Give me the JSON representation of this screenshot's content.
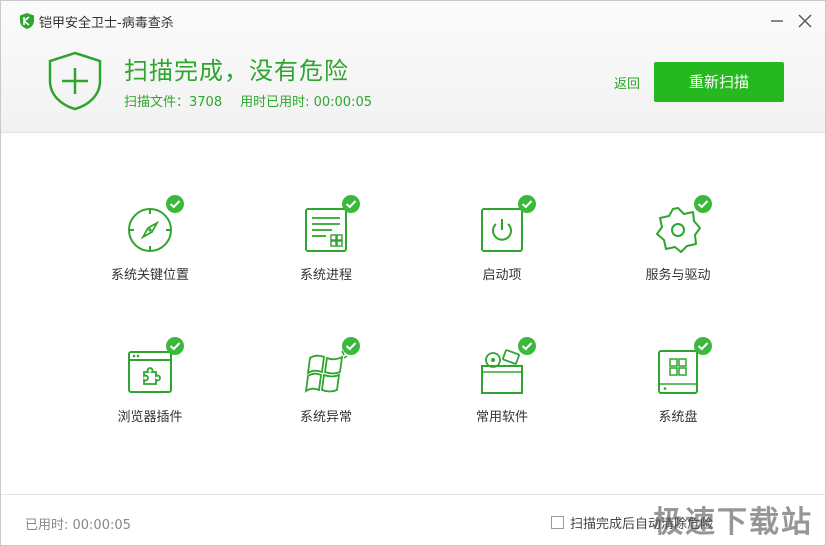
{
  "window": {
    "title": "铠甲安全卫士-病毒查杀"
  },
  "scan_result": {
    "headline": "扫描完成，没有危险",
    "files_label": "扫描文件：3708",
    "time_label": "用时已用时: 00:00:05"
  },
  "actions": {
    "back_label": "返回",
    "rescan_label": "重新扫描"
  },
  "scan_items": [
    {
      "label": "系统关键位置",
      "icon": "compass-icon",
      "status": "ok"
    },
    {
      "label": "系统进程",
      "icon": "process-window-icon",
      "status": "ok"
    },
    {
      "label": "启动项",
      "icon": "power-icon",
      "status": "ok"
    },
    {
      "label": "服务与驱动",
      "icon": "gear-icon",
      "status": "ok"
    },
    {
      "label": "浏览器插件",
      "icon": "browser-plugin-icon",
      "status": "ok"
    },
    {
      "label": "系统异常",
      "icon": "windows-flag-icon",
      "status": "ok"
    },
    {
      "label": "常用软件",
      "icon": "software-box-icon",
      "status": "ok"
    },
    {
      "label": "系统盘",
      "icon": "system-disk-icon",
      "status": "ok"
    }
  ],
  "footer": {
    "elapsed": "已用时: 00:00:05",
    "auto_clear_label": "扫描完成后自动清除危险",
    "auto_clear_checked": false,
    "watermark": "极速下载站"
  },
  "colors": {
    "accent": "#25b81f",
    "accent_text": "#2ea52e",
    "check_badge": "#3cb93c"
  }
}
